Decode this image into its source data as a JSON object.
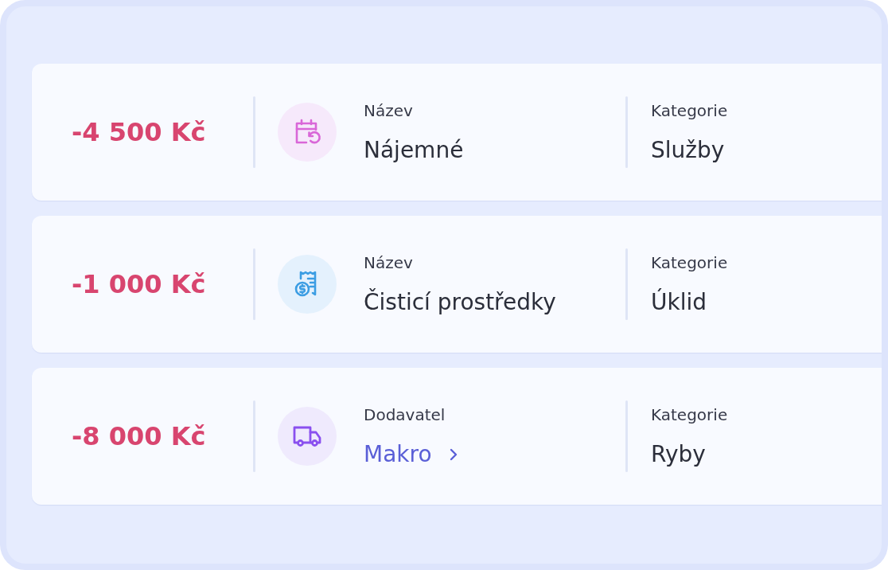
{
  "transactions": [
    {
      "kind": "recurring",
      "amount": "-4 500 Kč",
      "field": {
        "label": "Název",
        "value": "Nájemné",
        "kind": "text"
      },
      "category": {
        "label": "Kategorie",
        "value": "Služby"
      }
    },
    {
      "kind": "expense",
      "amount": "-1 000 Kč",
      "field": {
        "label": "Název",
        "value": "Čisticí prostředky",
        "kind": "text"
      },
      "category": {
        "label": "Kategorie",
        "value": "Úklid"
      }
    },
    {
      "kind": "supplier",
      "amount": "-8 000 Kč",
      "field": {
        "label": "Dodavatel",
        "value": "Makro",
        "kind": "link"
      },
      "category": {
        "label": "Kategorie",
        "value": "Ryby"
      }
    }
  ]
}
